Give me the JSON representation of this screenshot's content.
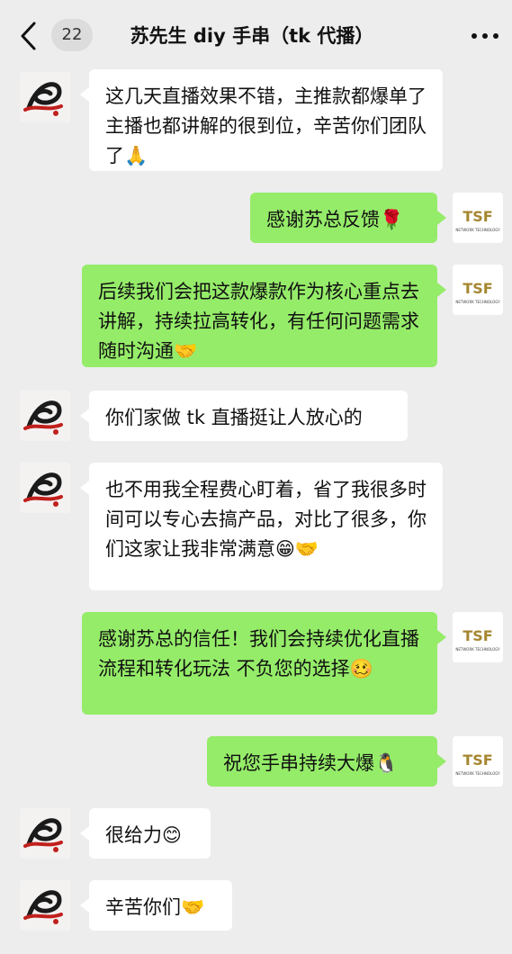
{
  "header": {
    "unread_count": "22",
    "title": "苏先生 diy 手串（tk 代播）"
  },
  "logo": {
    "brand": "TSF",
    "tagline": "NETWORK TECHNOLOGY",
    "brand_color": "#a5862f"
  },
  "messages": [
    {
      "from": "contact",
      "text": "这几天直播效果不错，主推款都爆单了主播也都讲解的很到位，辛苦你们团队了🙏"
    },
    {
      "from": "me",
      "text": "感谢苏总反馈🌹"
    },
    {
      "from": "me",
      "text": "后续我们会把这款爆款作为核心重点去讲解，持续拉高转化，有任何问题需求随时沟通🤝"
    },
    {
      "from": "contact",
      "text": "你们家做 tk 直播挺让人放心的"
    },
    {
      "from": "contact",
      "text": "也不用我全程费心盯着，省了我很多时间可以专心去搞产品，对比了很多，你们这家让我非常满意😁🤝"
    },
    {
      "from": "me",
      "text": "感谢苏总的信任！我们会持续优化直播流程和转化玩法 不负您的选择🥴"
    },
    {
      "from": "me",
      "text": "祝您手串持续大爆🐧"
    },
    {
      "from": "contact",
      "text": "很给力😊"
    },
    {
      "from": "contact",
      "text": "辛苦你们🤝"
    }
  ],
  "colors": {
    "chat_background": "#ededed",
    "incoming_bubble": "#ffffff",
    "outgoing_bubble": "#95ec69"
  }
}
